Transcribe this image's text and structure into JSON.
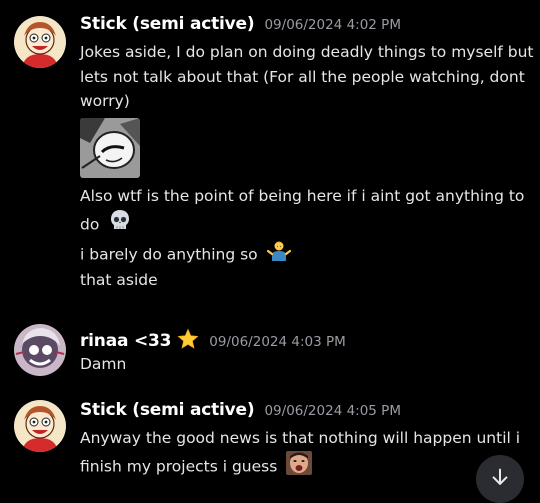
{
  "messages": [
    {
      "author": "Stick (semi active)",
      "timestamp": "09/06/2024 4:02 PM",
      "lines": [
        "Jokes aside, I do plan on doing deadly things to myself but",
        "lets not talk about that (For all the people watching, dont",
        "worry)",
        "Also wtf is the point of being here if i aint got anything to",
        "do",
        "i barely do anything so",
        "that aside"
      ]
    },
    {
      "author": "rinaa <33",
      "timestamp": "09/06/2024 4:03 PM",
      "lines": [
        "Damn"
      ]
    },
    {
      "author": "Stick (semi active)",
      "timestamp": "09/06/2024 4:05 PM",
      "lines": [
        "Anyway the good news is that nothing will happen until i",
        "finish my projects i guess"
      ]
    }
  ],
  "icons": {
    "skull": "skull-emoji",
    "shrug": "person-shrugging-emoji",
    "star": "star-icon",
    "jump": "arrow-down-icon"
  },
  "colors": {
    "background": "#000000",
    "username": "#ffffff",
    "timestamp": "#9a9ba3",
    "text": "#e6e6e8",
    "jump_button": "#2b2c31"
  }
}
